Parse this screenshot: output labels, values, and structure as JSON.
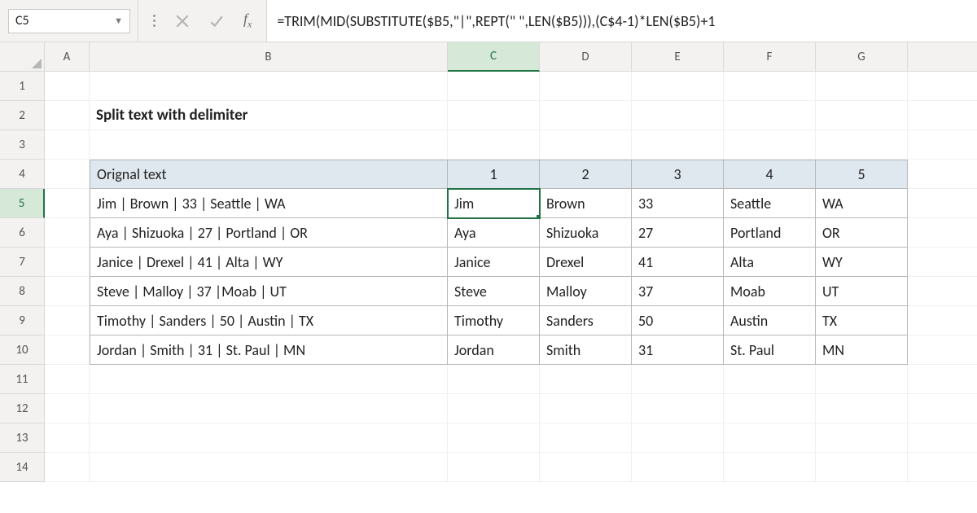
{
  "name_box": "C5",
  "formula_bar": "=TRIM(MID(SUBSTITUTE($B5,\"|\",REPT(\" \",LEN($B5))),(C$4-1)*LEN($B5)+1",
  "columns": [
    "A",
    "B",
    "C",
    "D",
    "E",
    "F",
    "G"
  ],
  "row_numbers": [
    "1",
    "2",
    "3",
    "4",
    "5",
    "6",
    "7",
    "8",
    "9",
    "10",
    "11",
    "12",
    "13",
    "14"
  ],
  "title": "Split text with delimiter",
  "table_headers": {
    "original": "Orignal text",
    "c1": "1",
    "c2": "2",
    "c3": "3",
    "c4": "4",
    "c5": "5"
  },
  "rows": [
    {
      "orig": "Jim | Brown | 33 | Seattle | WA",
      "c1": "Jim",
      "c2": "Brown",
      "c3": "33",
      "c4": "Seattle",
      "c5": "WA"
    },
    {
      "orig": "Aya | Shizuoka | 27 | Portland | OR",
      "c1": "Aya",
      "c2": "Shizuoka",
      "c3": "27",
      "c4": "Portland",
      "c5": "OR"
    },
    {
      "orig": "Janice | Drexel | 41 | Alta | WY",
      "c1": "Janice",
      "c2": "Drexel",
      "c3": "41",
      "c4": "Alta",
      "c5": "WY"
    },
    {
      "orig": "Steve | Malloy | 37 |Moab | UT",
      "c1": "Steve",
      "c2": "Malloy",
      "c3": "37",
      "c4": "Moab",
      "c5": "UT"
    },
    {
      "orig": "Timothy | Sanders | 50 | Austin | TX",
      "c1": "Timothy",
      "c2": "Sanders",
      "c3": "50",
      "c4": "Austin",
      "c5": "TX"
    },
    {
      "orig": "Jordan | Smith | 31 | St. Paul | MN",
      "c1": "Jordan",
      "c2": "Smith",
      "c3": "31",
      "c4": "St. Paul",
      "c5": "MN"
    }
  ],
  "active": {
    "col": "C",
    "row": 5
  }
}
